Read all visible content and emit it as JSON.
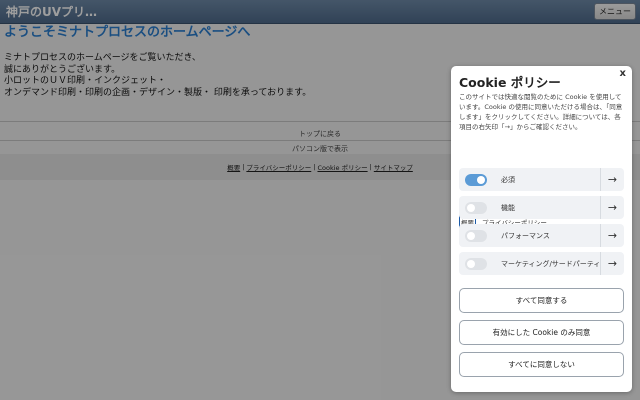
{
  "header": {
    "site_title": "神戸のUVプリ…",
    "menu_label": "メニュー"
  },
  "main": {
    "welcome": "ようこそミナトプロセスのホームページへ",
    "intro_lines": [
      "ミナトプロセスのホームページをご覧いただき、",
      "誠にありがとうございます。",
      "小ロットのＵＶ印刷・インクジェット・",
      "オンデマンド印刷・印刷の企画・デザイン・製版・ 印刷を承っております。"
    ],
    "back_to_top": "トップに戻る",
    "pc_version": "パソコン版で表示"
  },
  "footer": {
    "links": [
      "概要",
      "プライバシーポリシー",
      "Cookie ポリシー",
      "サイトマップ"
    ],
    "separator": "|"
  },
  "cookie_panel": {
    "title": "Cookie ポリシー",
    "close": "x",
    "description": "このサイトでは快適な閲覧のために Cookie を使用しています。Cookie の使用に同意いただける場合は、「同意します」をクリックしてください。詳細については、各項目の右矢印「→」からご確認ください。",
    "link_summary": "概要",
    "link_privacy": "プライバシーポリシー",
    "categories": [
      {
        "label": "必須",
        "enabled": true
      },
      {
        "label": "機能",
        "enabled": false
      },
      {
        "label": "パフォーマンス",
        "enabled": false
      },
      {
        "label": "マーケティング/サードパーティ",
        "enabled": false
      }
    ],
    "arrow": "→",
    "buttons": {
      "accept_all": "すべて同意する",
      "accept_selected": "有効にした Cookie のみ同意",
      "reject_all": "すべてに同意しない"
    }
  },
  "colors": {
    "accent_blue": "#2a7fd0",
    "toggle_on": "#5b9bd6",
    "header_bar": "#5b7798"
  }
}
